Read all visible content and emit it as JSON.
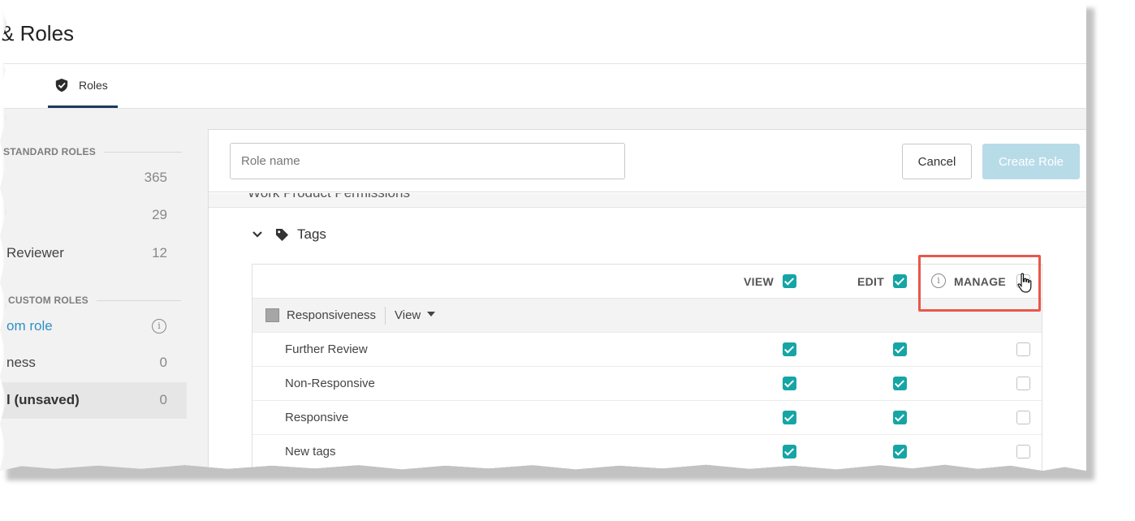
{
  "header": {
    "title": "& Roles"
  },
  "tabs": [
    {
      "label": "Roles",
      "icon": "shield-check-icon",
      "active": true
    }
  ],
  "sidebar": {
    "standard_heading": "STANDARD ROLES",
    "standard_roles": [
      {
        "label": "",
        "count": "365"
      },
      {
        "label": "",
        "count": "29"
      },
      {
        "label": "Reviewer",
        "count": "12"
      }
    ],
    "custom_heading": "CUSTOM ROLES",
    "custom_roles": [
      {
        "label": "om role",
        "count": "",
        "link": true
      },
      {
        "label": "ness",
        "count": "0"
      },
      {
        "label": "l (unsaved)",
        "count": "0",
        "selected": true
      }
    ]
  },
  "form": {
    "role_name_placeholder": "Role name",
    "role_name_value": "",
    "cancel_label": "Cancel",
    "create_label": "Create Role"
  },
  "section_peek_text": "Work Product Permissions",
  "tags_section": {
    "title": "Tags",
    "columns": {
      "view": "VIEW",
      "edit": "EDIT",
      "manage": "MANAGE"
    },
    "header_checks": {
      "view": true,
      "edit": true,
      "manage": false
    },
    "group": {
      "name": "Responsiveness",
      "dropdown_value": "View"
    },
    "rows": [
      {
        "name": "Further Review",
        "view": true,
        "edit": true,
        "manage": false
      },
      {
        "name": "Non-Responsive",
        "view": true,
        "edit": true,
        "manage": false
      },
      {
        "name": "Responsive",
        "view": true,
        "edit": true,
        "manage": false
      },
      {
        "name": "New tags",
        "view": true,
        "edit": true,
        "manage": false
      }
    ]
  },
  "colors": {
    "accent_teal": "#16a5a5",
    "create_button_disabled": "#b8dbe8",
    "link_blue": "#2f8fc6",
    "highlight_red": "#e8574a",
    "tab_underline": "#1d3a5c"
  }
}
